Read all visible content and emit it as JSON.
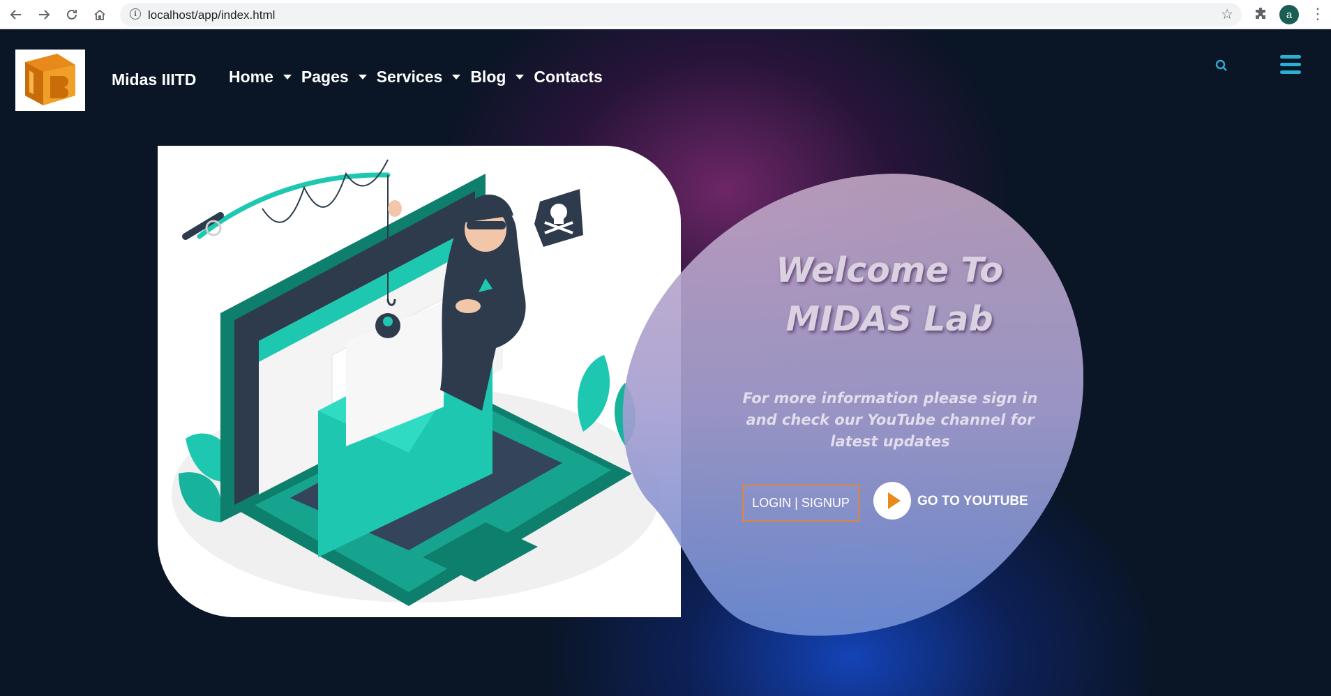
{
  "browser": {
    "url": "localhost/app/index.html",
    "profile_initial": "a"
  },
  "header": {
    "brand": "Midas IIITD",
    "menu": [
      {
        "label": "Home",
        "dropdown": true
      },
      {
        "label": "Pages",
        "dropdown": true
      },
      {
        "label": "Services",
        "dropdown": true
      },
      {
        "label": "Blog",
        "dropdown": true
      },
      {
        "label": "Contacts",
        "dropdown": false
      }
    ]
  },
  "hero": {
    "title_line1": "Welcome To",
    "title_line2": "MIDAS Lab",
    "subtitle": "For more information please sign in and check our YouTube channel for latest updates",
    "login_label": "LOGIN | SIGNUP",
    "youtube_label": "GO TO YOUTUBE"
  },
  "colors": {
    "accent": "#2ab0d1",
    "teal": "#1ec8b0",
    "orange": "#e8891c",
    "background": "#0a1526"
  }
}
